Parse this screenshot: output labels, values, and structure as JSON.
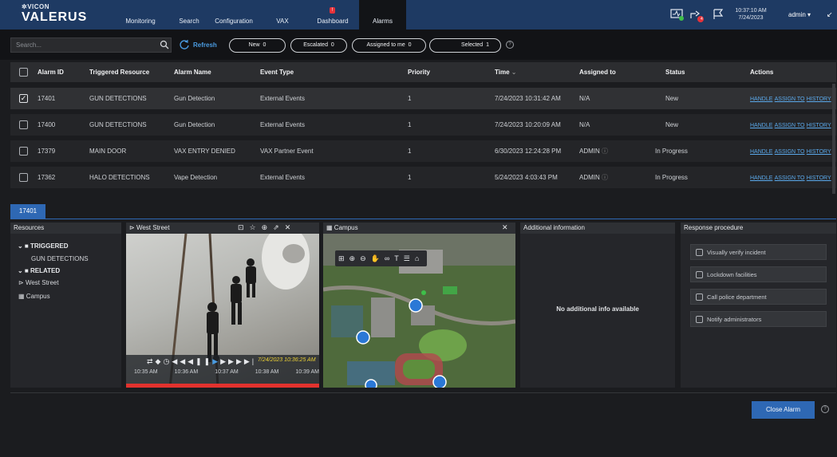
{
  "app": {
    "logo_small": "VICON",
    "logo_main": "VALERUS"
  },
  "nav": [
    "Monitoring",
    "Search",
    "Configuration",
    "VAX",
    "Dashboard",
    "Alarms"
  ],
  "nav_active": "Alarms",
  "dashboard_badge": "!",
  "header": {
    "time": "10:37:10 AM",
    "date": "7/24/2023",
    "user": "admin",
    "share_badge": "4"
  },
  "toolbar": {
    "search_placeholder": "Search...",
    "refresh": "Refresh",
    "filters": [
      {
        "label": "New",
        "count": "0"
      },
      {
        "label": "Escalated",
        "count": "0"
      },
      {
        "label": "Assigned to me",
        "count": "0"
      },
      {
        "label": "Selected",
        "count": "1"
      }
    ]
  },
  "table": {
    "columns": [
      "Alarm ID",
      "Triggered Resource",
      "Alarm Name",
      "Event Type",
      "Priority",
      "Time",
      "Assigned to",
      "Status",
      "Actions"
    ],
    "rows": [
      {
        "id": "17401",
        "resource": "GUN DETECTIONS",
        "name": "Gun Detection",
        "event": "External Events",
        "priority": "1",
        "time": "7/24/2023 10:31:42 AM",
        "assigned": "N/A",
        "status": "New",
        "checked": true
      },
      {
        "id": "17400",
        "resource": "GUN DETECTIONS",
        "name": "Gun Detection",
        "event": "External Events",
        "priority": "1",
        "time": "7/24/2023 10:20:09 AM",
        "assigned": "N/A",
        "status": "New",
        "checked": false
      },
      {
        "id": "17379",
        "resource": "MAIN DOOR",
        "name": "VAX ENTRY DENIED",
        "event": "VAX Partner Event",
        "priority": "1",
        "time": "6/30/2023 12:24:28 PM",
        "assigned": "ADMIN",
        "status": "In Progress",
        "checked": false
      },
      {
        "id": "17362",
        "resource": "HALO DETECTIONS",
        "name": "Vape Detection",
        "event": "External Events",
        "priority": "1",
        "time": "5/24/2023 4:03:43 PM",
        "assigned": "ADMIN",
        "status": "In Progress",
        "checked": false
      }
    ],
    "actions": [
      "HANDLE",
      "ASSIGN TO",
      "HISTORY"
    ]
  },
  "detail_tab": "17401",
  "resources": {
    "title": "Resources",
    "triggered": "TRIGGERED",
    "triggered_item": "GUN DETECTIONS",
    "related": "RELATED",
    "related_items": [
      "West Street",
      "Campus"
    ]
  },
  "camera": {
    "title": "West Street",
    "overlay_time": "7/24/2023 10:36:25 AM",
    "timeline_labels": [
      "10:35 AM",
      "10:36 AM",
      "10:37 AM",
      "10:38 AM",
      "10:39 AM"
    ]
  },
  "map": {
    "title": "Campus"
  },
  "additional": {
    "title": "Additional information",
    "empty": "No additional info available"
  },
  "response": {
    "title": "Response procedure",
    "items": [
      "Visually verify incident",
      "Lockdown facilities",
      "Call police department",
      "Notify administrators"
    ]
  },
  "footer": {
    "close": "Close Alarm"
  },
  "colors": {
    "topbar": "#1e3a63",
    "accent": "#2e68b4",
    "link": "#5aa8ea"
  }
}
